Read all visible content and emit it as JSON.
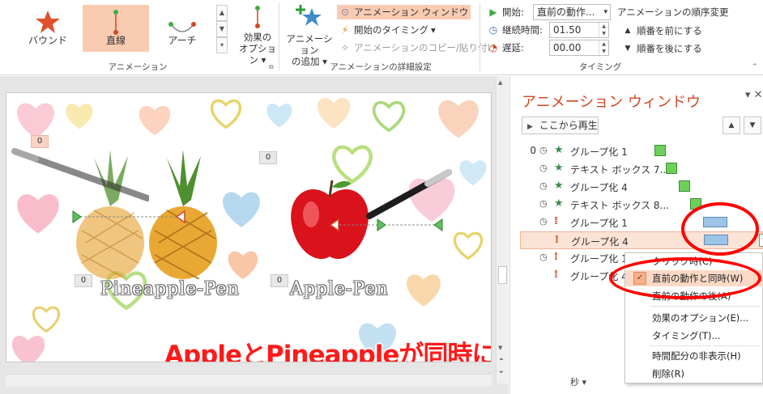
{
  "ribbon": {
    "gallery": [
      {
        "label": "バウンド",
        "selected": false
      },
      {
        "label": "直線",
        "selected": true
      },
      {
        "label": "アーチ",
        "selected": false
      }
    ],
    "effect_options_label_1": "効果の",
    "effect_options_label_2": "オプション",
    "animation_group_label": "アニメーション",
    "add_animation_label_1": "アニメーション",
    "add_animation_label_2": "の追加",
    "animation_pane_btn": "アニメーション ウィンドウ",
    "trigger_btn": "開始のタイミング",
    "painter_btn": "アニメーションのコピー/貼り付け",
    "advanced_group_label": "アニメーションの詳細設定",
    "start_label": "開始:",
    "start_value": "直前の動作...",
    "duration_label": "継続時間:",
    "duration_value": "01.50",
    "delay_label": "遅延:",
    "delay_value": "00.00",
    "reorder_title": "アニメーションの順序変更",
    "move_earlier": "順番を前にする",
    "move_later": "順番を後にする",
    "timing_group_label": "タイミング"
  },
  "slide": {
    "tags": [
      "0",
      "0",
      "0",
      "0"
    ],
    "pineapple_pen": "Pineapple-Pen",
    "apple_pen": "Apple-Pen",
    "caption": "AppleとPineappleが同時に動く"
  },
  "pane": {
    "title": "アニメーション ウィンドウ",
    "play_from": "ここから再生",
    "rows": [
      {
        "num": "0",
        "name": "グループ化 1",
        "kind": "star"
      },
      {
        "num": "",
        "name": "テキスト ボックス 7...",
        "kind": "star"
      },
      {
        "num": "",
        "name": "グループ化 4",
        "kind": "star"
      },
      {
        "num": "",
        "name": "テキスト ボックス 8...",
        "kind": "star"
      },
      {
        "num": "",
        "name": "グループ化 1",
        "kind": "path"
      },
      {
        "num": "",
        "name": "グループ化 4",
        "kind": "path"
      },
      {
        "num": "",
        "name": "グループ化 1",
        "kind": "path"
      },
      {
        "num": "",
        "name": "グループ化 4",
        "kind": "path"
      }
    ],
    "seconds_label": "秒"
  },
  "context_menu": {
    "items": [
      {
        "label": "クリック時(C)",
        "checked": false
      },
      {
        "label": "直前の動作と同時(W)",
        "checked": true
      },
      {
        "label": "直前の動作の後(A)",
        "checked": false
      },
      {
        "label": "効果のオプション(E)...",
        "checked": false
      },
      {
        "label": "タイミング(T)...",
        "checked": false
      },
      {
        "label": "時間配分の非表示(H)",
        "checked": false
      },
      {
        "label": "削除(R)",
        "checked": false
      }
    ]
  },
  "colors": {
    "accent": "#d24726",
    "selected_fill": "#f9cbb1",
    "caption_red": "#ff1a1a",
    "bar_green": "#6ed05a",
    "bar_blue": "#9dc3e6"
  }
}
